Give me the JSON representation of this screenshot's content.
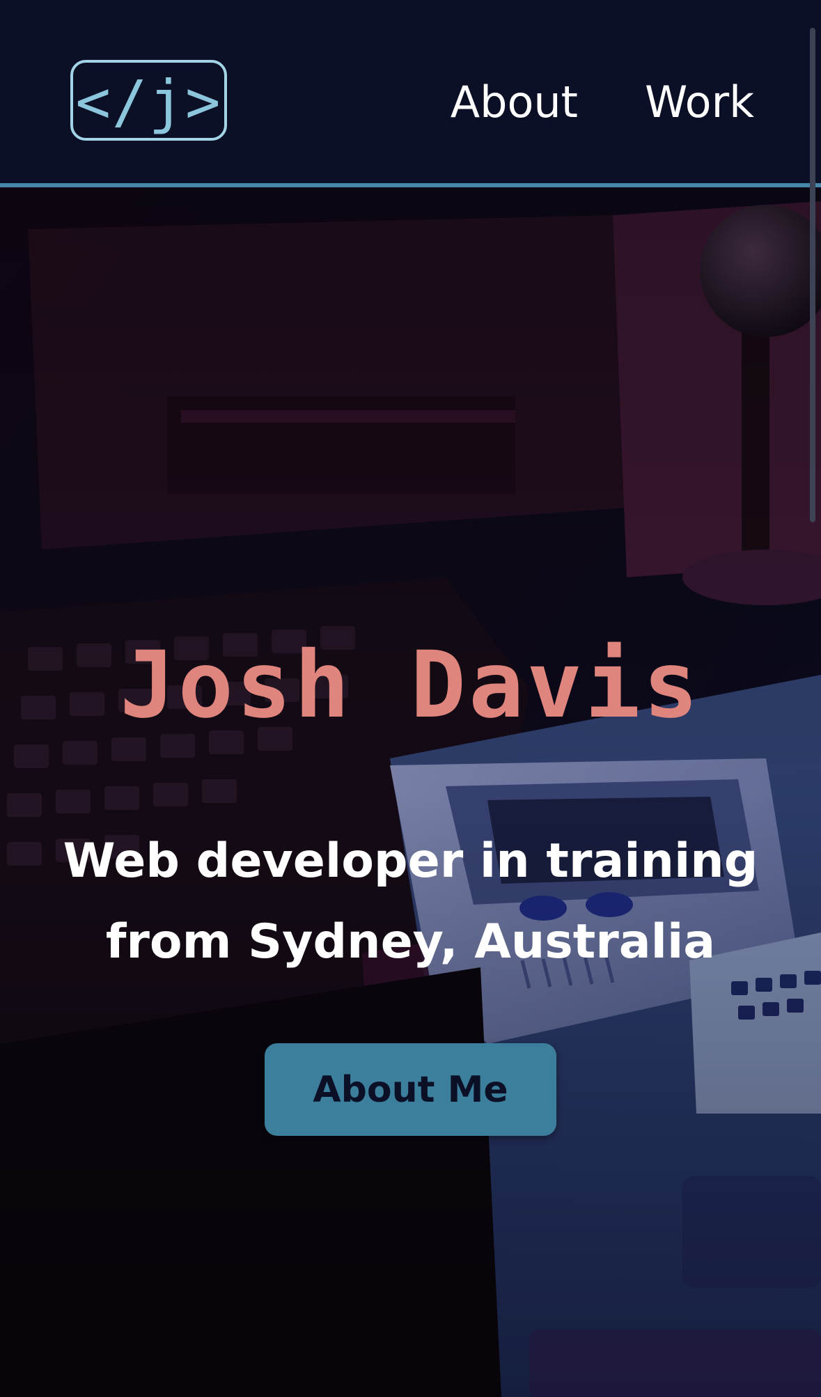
{
  "header": {
    "logo_text": "</j>",
    "nav": [
      {
        "label": "About"
      },
      {
        "label": "Work"
      }
    ]
  },
  "hero": {
    "name": "Josh Davis",
    "tagline_line1": "Web developer in training",
    "tagline_line2": "from Sydney, Australia",
    "cta_label": "About Me",
    "background_image": "retro computer desk with keyboard, joystick and handheld game console"
  },
  "colors": {
    "header_bg": "#0b1027",
    "accent_line": "#4686a8",
    "logo": "#a3d3e6",
    "name": "#df857d",
    "cta_bg": "#3c7f9c",
    "cta_text": "#0b1027",
    "text": "#ffffff"
  }
}
